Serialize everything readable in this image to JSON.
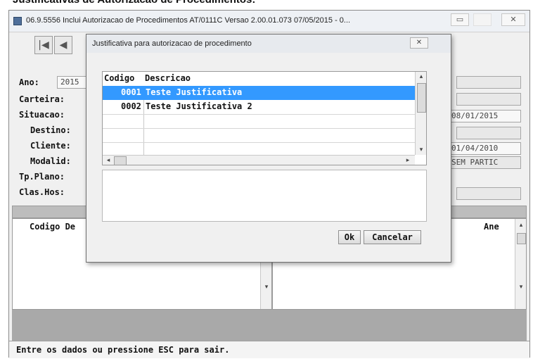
{
  "caption": "Justificativas de Autorizacao de Procedimentos:",
  "window": {
    "title": "06.9.5556    Inclui  Autorizacao de Procedimentos AT/0111C Versao 2.00.01.073 07/05/2015 - 0...",
    "controls": {
      "minimize": "▭",
      "close": "✕"
    }
  },
  "nav": {
    "first": "|◀",
    "prev": "◀"
  },
  "form": {
    "fields": [
      {
        "label": "Ano:",
        "value": "2015"
      },
      {
        "label": "Carteira:",
        "value": ""
      },
      {
        "label": "Situacao:",
        "value": "08/01/2015"
      },
      {
        "label": "Destino:",
        "value": ""
      },
      {
        "label": "Cliente:",
        "value": "01/04/2010"
      },
      {
        "label": "Modalid:",
        "value": "SEM PARTIC"
      },
      {
        "label": "Tp.Plano:",
        "value": ""
      },
      {
        "label": "Clas.Hos:",
        "value": ""
      }
    ]
  },
  "lower_grid": {
    "col1": "Codigo De",
    "col_right": "Ane"
  },
  "status": "Entre os dados ou pressione ESC para sair.",
  "dialog": {
    "title": "Justificativa para autorizacao de procedimento",
    "close": "✕",
    "columns": {
      "codigo": "Codigo",
      "descricao": "Descricao"
    },
    "rows": [
      {
        "codigo": "0001",
        "descricao": "Teste Justificativa",
        "selected": true
      },
      {
        "codigo": "0002",
        "descricao": "Teste Justificativa 2",
        "selected": false
      }
    ],
    "buttons": {
      "ok": "Ok",
      "cancel": "Cancelar"
    }
  }
}
